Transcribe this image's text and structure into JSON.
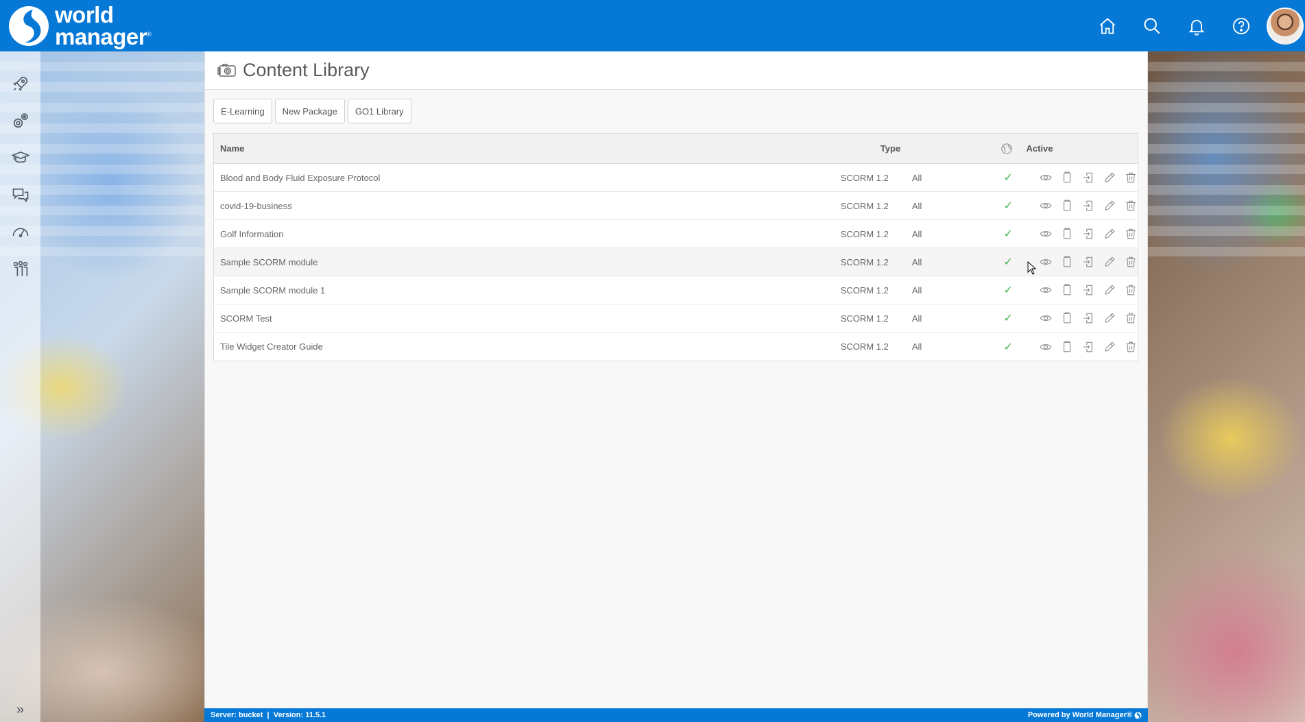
{
  "brand": {
    "line1": "world",
    "line2": "manager",
    "mark": "®"
  },
  "topbar": {
    "icons": [
      "home-icon",
      "search-icon",
      "bell-icon",
      "help-icon"
    ]
  },
  "rail": {
    "icons": [
      "rocket-icon",
      "gears-icon",
      "education-icon",
      "chat-icon",
      "dashboard-icon",
      "people-icon"
    ],
    "expand": "»"
  },
  "page": {
    "title": "Content Library",
    "title_icon": "camera-icon"
  },
  "buttons": {
    "elearning": "E-Learning",
    "new_package": "New Package",
    "go1": "GO1 Library"
  },
  "table": {
    "headers": {
      "name": "Name",
      "type": "Type",
      "globe": "globe-icon",
      "active": "Active"
    },
    "rows": [
      {
        "name": "Blood and Body Fluid Exposure Protocol",
        "type": "SCORM 1.2",
        "audience": "All",
        "active": "✓"
      },
      {
        "name": "covid-19-business",
        "type": "SCORM 1.2",
        "audience": "All",
        "active": "✓"
      },
      {
        "name": "Golf Information",
        "type": "SCORM 1.2",
        "audience": "All",
        "active": "✓"
      },
      {
        "name": "Sample SCORM module",
        "type": "SCORM 1.2",
        "audience": "All",
        "active": "✓"
      },
      {
        "name": "Sample SCORM module 1",
        "type": "SCORM 1.2",
        "audience": "All",
        "active": "✓"
      },
      {
        "name": "SCORM Test",
        "type": "SCORM 1.2",
        "audience": "All",
        "active": "✓"
      },
      {
        "name": "Tile Widget Creator Guide",
        "type": "SCORM 1.2",
        "audience": "All",
        "active": "✓"
      }
    ],
    "row_actions": [
      "view-icon",
      "copy-icon",
      "export-icon",
      "edit-icon",
      "delete-icon"
    ]
  },
  "footer": {
    "left": "Server: bucket  |  Version: 11.5.1",
    "right": "Powered by World Manager®"
  },
  "colors": {
    "brand_blue": "#0679d6",
    "check_green": "#4caf50",
    "icon_grey": "#8a8a8a"
  }
}
